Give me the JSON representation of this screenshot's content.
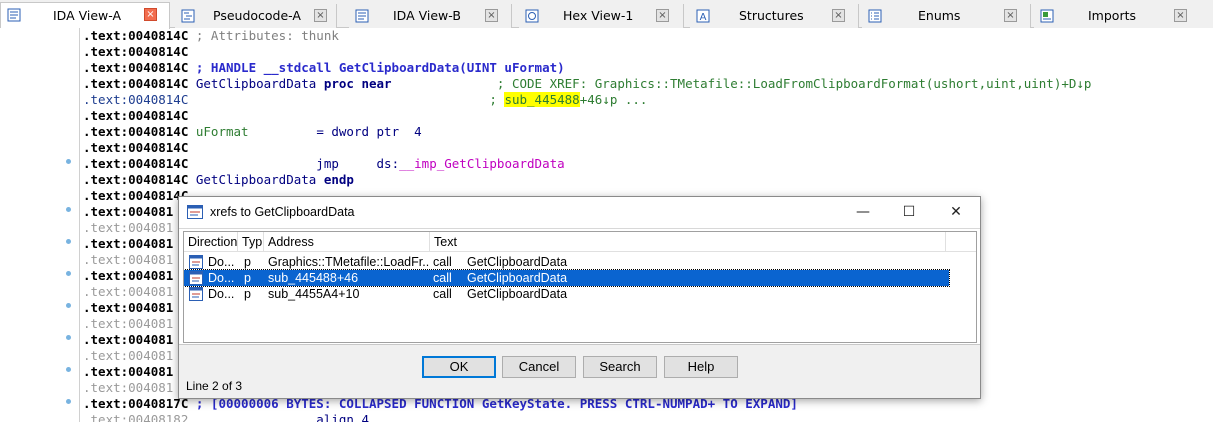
{
  "tabs": [
    {
      "label": "IDA View-A",
      "icon": "listing-view-icon"
    },
    {
      "label": "Pseudocode-A",
      "icon": "pseudocode-icon"
    },
    {
      "label": "IDA View-B",
      "icon": "listing-view-icon"
    },
    {
      "label": "Hex View-1",
      "icon": "hex-view-icon"
    },
    {
      "label": "Structures",
      "icon": "structures-icon"
    },
    {
      "label": "Enums",
      "icon": "enums-icon"
    },
    {
      "label": "Imports",
      "icon": "imports-icon"
    }
  ],
  "close_glyph": "×",
  "listing": {
    "l0": {
      "addr": ".text:0040814C",
      "rest": " ; Attributes: thunk"
    },
    "l1": {
      "addr": ".text:0040814C"
    },
    "l2": {
      "addr": ".text:0040814C",
      "rest": " ; HANDLE __stdcall GetClipboardData(UINT uFormat)"
    },
    "l3": {
      "addr": ".text:0040814C",
      "name": " GetClipboardData",
      "kw": " proc near",
      "pad": "              ",
      "xref": "; CODE XREF: Graphics::TMetafile::LoadFromClipboardFormat(ushort,uint,uint)+D↓p"
    },
    "l4": {
      "addr": ".text:0040814C",
      "pad": "                                        ",
      "semi": "; ",
      "sub": "sub_445488",
      "rest": "+46↓p ..."
    },
    "l5": {
      "addr": ".text:0040814C"
    },
    "l6": {
      "addr": ".text:0040814C",
      "name": " uFormat",
      "pad": "         ",
      "rest": "= dword ptr  4"
    },
    "l7": {
      "addr": ".text:0040814C"
    },
    "l8": {
      "addr": ".text:0040814C",
      "pad": "                 ",
      "op": "jmp",
      "pad2": "     ",
      "seg": "ds:",
      "target": "__imp_GetClipboardData"
    },
    "l9": {
      "addr": ".text:0040814C",
      "name": " GetClipboardData",
      "kw": " endp"
    },
    "l10": {
      "addr": ".text:0040814C"
    },
    "partial": [
      ".text:004081",
      ".text:004081",
      ".text:004081",
      ".text:004081",
      ".text:004081",
      ".text:004081",
      ".text:004081",
      ".text:004081",
      ".text:004081",
      ".text:004081",
      ".text:004081",
      ".text:004081"
    ],
    "l23": {
      "addr": ".text:0040817C",
      "rest": " ; [00000006 BYTES: COLLAPSED FUNCTION GetKeyState. PRESS CTRL-NUMPAD+ TO EXPAND]"
    },
    "l24": {
      "addr": ".text:00408182",
      "pad": "                 ",
      "rest": "align 4"
    }
  },
  "dialog": {
    "title": "xrefs to GetClipboardData",
    "controls": {
      "minimize": "—",
      "maximize": "☐",
      "close": "✕"
    },
    "columns": [
      "Direction",
      "Typ",
      "Address",
      "Text"
    ],
    "rows": [
      {
        "direction": "Do...",
        "type": "p",
        "address": "Graphics::TMetafile::LoadFr...",
        "op": "call",
        "target": "GetClipboardData",
        "selected": false
      },
      {
        "direction": "Do...",
        "type": "p",
        "address": "sub_445488+46",
        "op": "call",
        "target": "GetClipboardData",
        "selected": true
      },
      {
        "direction": "Do...",
        "type": "p",
        "address": "sub_4455A4+10",
        "op": "call",
        "target": "GetClipboardData",
        "selected": false
      }
    ],
    "buttons": {
      "ok": "OK",
      "cancel": "Cancel",
      "search": "Search",
      "help": "Help"
    },
    "status": "Line 2 of 3"
  },
  "colors": {
    "selection": "#0a64d0",
    "highlight": "#ffff00",
    "xref_green": "#2e7d32",
    "import_magenta": "#c000c0"
  }
}
